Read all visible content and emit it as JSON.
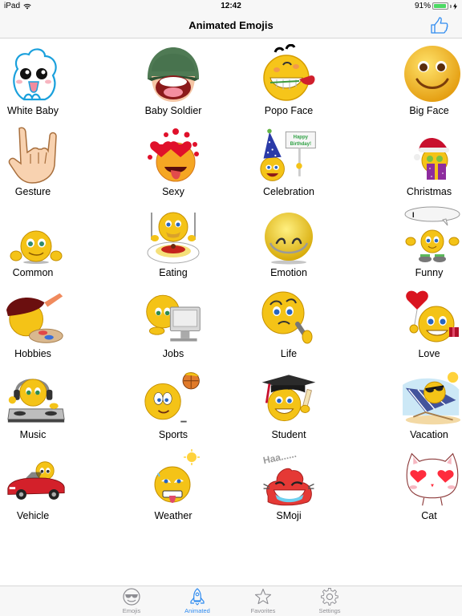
{
  "status_bar": {
    "device": "iPad",
    "time": "12:42",
    "battery_percent_label": "91%",
    "battery_level": 0.91,
    "battery_color": "#4cd964"
  },
  "nav_bar": {
    "title": "Animated Emojis",
    "right_button_icon": "thumbs-up-icon",
    "accent_color": "#2f8bf0"
  },
  "categories": [
    {
      "label": "White Baby",
      "icon": "white-baby-icon"
    },
    {
      "label": "Baby Soldier",
      "icon": "baby-soldier-icon"
    },
    {
      "label": "Popo Face",
      "icon": "popo-face-icon"
    },
    {
      "label": "Big Face",
      "icon": "big-face-icon"
    },
    {
      "label": "Gesture",
      "icon": "gesture-icon"
    },
    {
      "label": "Sexy",
      "icon": "sexy-icon"
    },
    {
      "label": "Celebration",
      "icon": "celebration-icon",
      "sign_text": "Happy Birthday!"
    },
    {
      "label": "Christmas",
      "icon": "christmas-icon"
    },
    {
      "label": "Common",
      "icon": "common-icon"
    },
    {
      "label": "Eating",
      "icon": "eating-icon"
    },
    {
      "label": "Emotion",
      "icon": "emotion-icon"
    },
    {
      "label": "Funny",
      "icon": "funny-icon",
      "bubble_text": "I"
    },
    {
      "label": "Hobbies",
      "icon": "hobbies-icon"
    },
    {
      "label": "Jobs",
      "icon": "jobs-icon"
    },
    {
      "label": "Life",
      "icon": "life-icon"
    },
    {
      "label": "Love",
      "icon": "love-icon"
    },
    {
      "label": "Music",
      "icon": "music-icon"
    },
    {
      "label": "Sports",
      "icon": "sports-icon"
    },
    {
      "label": "Student",
      "icon": "student-icon"
    },
    {
      "label": "Vacation",
      "icon": "vacation-icon"
    },
    {
      "label": "Vehicle",
      "icon": "vehicle-icon"
    },
    {
      "label": "Weather",
      "icon": "weather-icon"
    },
    {
      "label": "SMoji",
      "icon": "smoji-icon",
      "caption_text": "Haa......"
    },
    {
      "label": "Cat",
      "icon": "cat-icon"
    }
  ],
  "tab_bar": {
    "tabs": [
      {
        "label": "Emojis",
        "icon": "sunglasses-face-icon",
        "active": false
      },
      {
        "label": "Animated",
        "icon": "rocket-icon",
        "active": true
      },
      {
        "label": "Favorites",
        "icon": "star-icon",
        "active": false
      },
      {
        "label": "Settings",
        "icon": "gear-icon",
        "active": false
      }
    ],
    "active_color": "#2f8bf0",
    "inactive_color": "#8e8e93"
  }
}
